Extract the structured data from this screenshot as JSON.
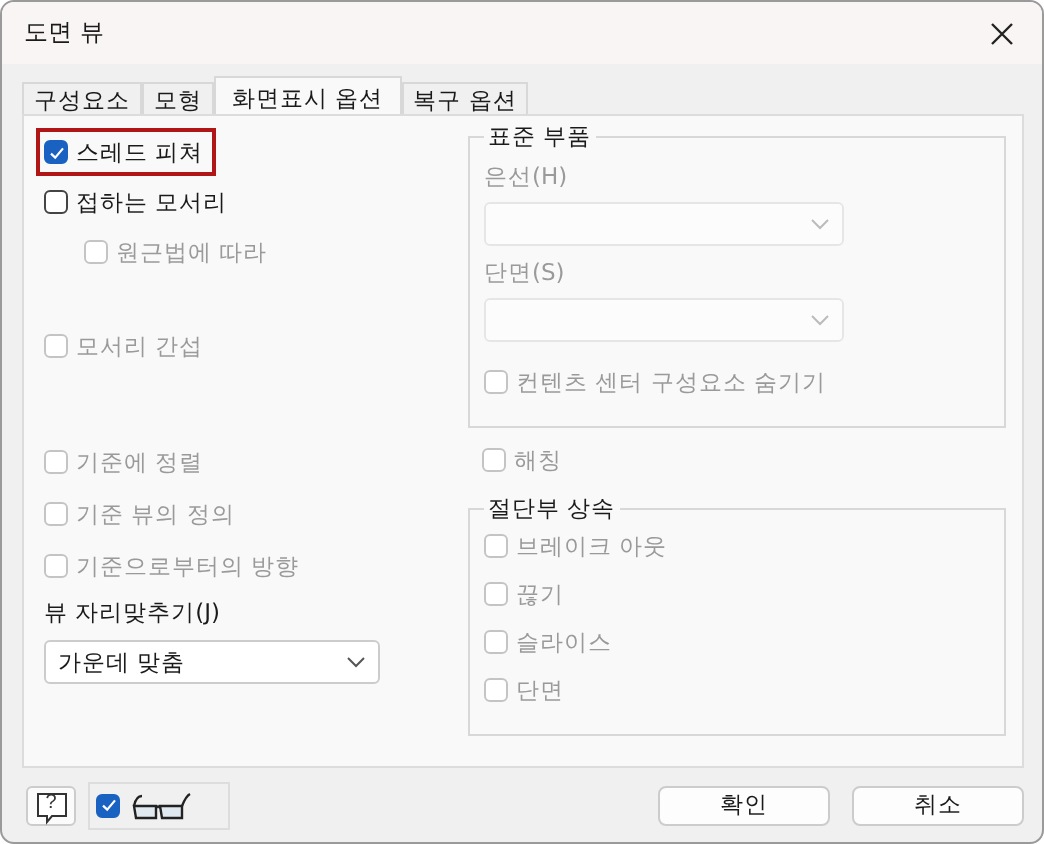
{
  "window": {
    "title": "도면 뷰"
  },
  "tabs": [
    {
      "label": "구성요소",
      "selected": false
    },
    {
      "label": "모형",
      "selected": false
    },
    {
      "label": "화면표시 옵션",
      "selected": true
    },
    {
      "label": "복구 옵션",
      "selected": false
    }
  ],
  "left": {
    "groups": [
      [
        {
          "label": "스레드 피쳐",
          "checked": true,
          "disabled": false,
          "highlighted": true
        },
        {
          "label": "접하는 모서리",
          "checked": false,
          "disabled": false,
          "children": [
            {
              "label": "원근법에 따라",
              "checked": false,
              "disabled": true
            }
          ]
        }
      ],
      [
        {
          "label": "모서리 간섭",
          "checked": false,
          "disabled": true
        }
      ],
      [
        {
          "label": "기준에 정렬",
          "checked": false,
          "disabled": true
        },
        {
          "label": "기준 뷰의 정의",
          "checked": false,
          "disabled": true
        },
        {
          "label": "기준으로부터의 방향",
          "checked": false,
          "disabled": true
        }
      ]
    ],
    "alignment": {
      "label": "뷰 자리맞추기(J)",
      "value": "가운데 맞춤",
      "disabled": false
    }
  },
  "standard_parts": {
    "title": "표준 부품",
    "combos": [
      {
        "label": "은선(H)",
        "disabled": true
      },
      {
        "label": "단면(S)",
        "disabled": true
      }
    ],
    "hide_content_center": {
      "label": "컨텐츠 센터 구성요소 숨기기",
      "checked": false,
      "disabled": true
    }
  },
  "hatching": {
    "label": "해칭",
    "checked": false,
    "disabled": true
  },
  "section_inheritance": {
    "title": "절단부 상속",
    "items": [
      {
        "label": "브레이크 아웃",
        "checked": false,
        "disabled": true
      },
      {
        "label": "끊기",
        "checked": false,
        "disabled": true
      },
      {
        "label": "슬라이스",
        "checked": false,
        "disabled": true
      },
      {
        "label": "단면",
        "checked": false,
        "disabled": true
      }
    ]
  },
  "footer": {
    "help": "?",
    "preview_checked": true,
    "buttons": [
      "확인",
      "취소"
    ]
  }
}
